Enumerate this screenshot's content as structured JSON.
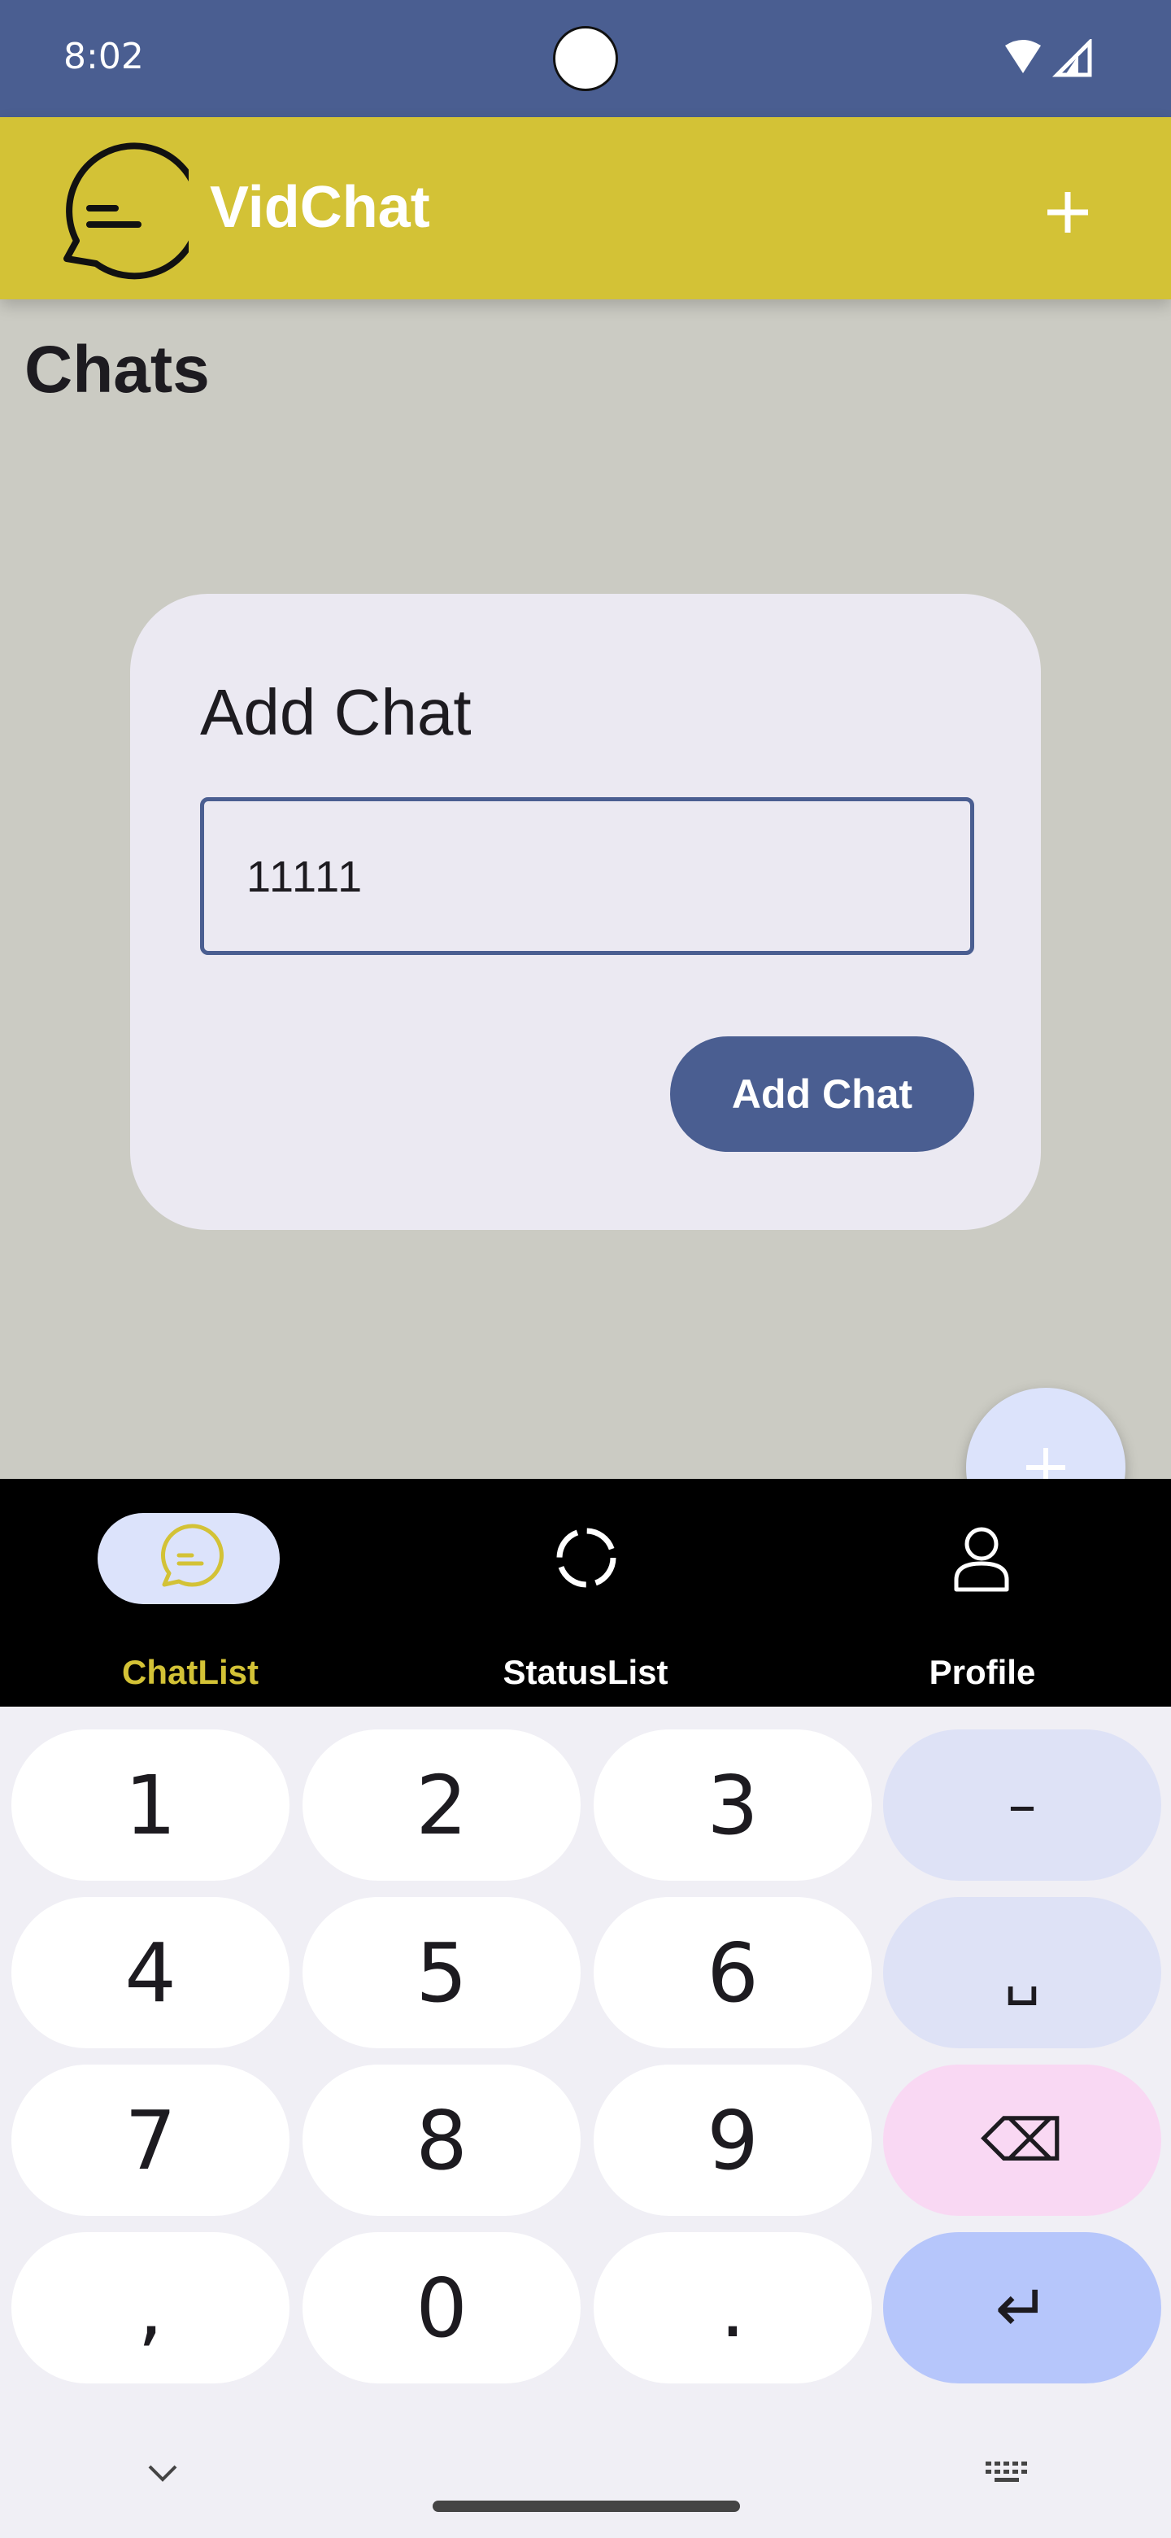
{
  "status_bar": {
    "time": "8:02"
  },
  "app_bar": {
    "title": "VidChat",
    "add_icon": "plus-icon",
    "logo_icon": "chat-bubble-logo-icon"
  },
  "page": {
    "title": "Chats"
  },
  "dialog": {
    "title": "Add Chat",
    "input_value": "11111",
    "confirm_label": "Add Chat"
  },
  "fab": {
    "icon": "plus-icon"
  },
  "bottom_nav": {
    "items": [
      {
        "label": "ChatList",
        "icon": "chat-bubble-icon",
        "selected": true
      },
      {
        "label": "StatusList",
        "icon": "status-ring-icon",
        "selected": false
      },
      {
        "label": "Profile",
        "icon": "person-icon",
        "selected": false
      }
    ]
  },
  "keyboard": {
    "keys": [
      "1",
      "2",
      "3",
      "–",
      "4",
      "5",
      "6",
      "␣",
      "7",
      "8",
      "9",
      "⌫",
      ",",
      "0",
      ".",
      "↵"
    ]
  },
  "colors": {
    "primary": "#4a5e91",
    "app_bar": "#d3c236",
    "background": "#cbcbc3",
    "dialog": "#ebe9f2",
    "selected_nav": "#d3c236"
  }
}
